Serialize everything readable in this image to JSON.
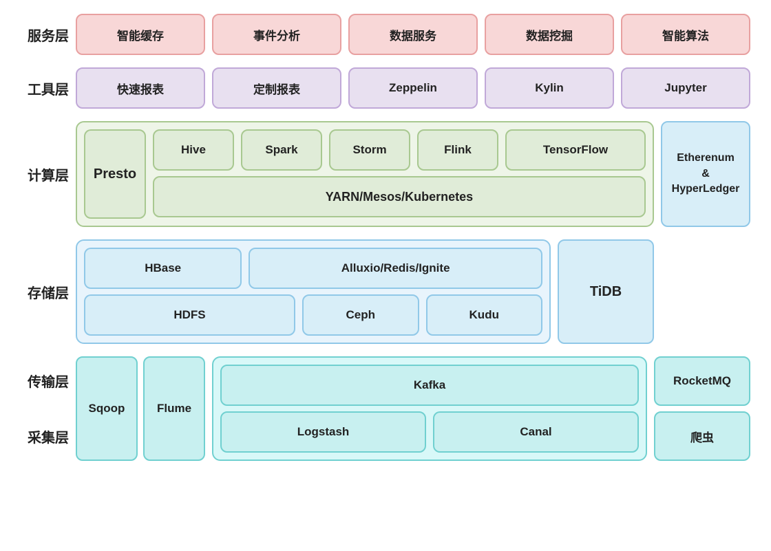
{
  "layers": {
    "service": {
      "label": "服务层",
      "items": [
        "智能缓存",
        "事件分析",
        "数据服务",
        "数据挖掘",
        "智能算法"
      ]
    },
    "tool": {
      "label": "工具层",
      "items": [
        "快速报表",
        "定制报表",
        "Zeppelin",
        "Kylin",
        "Jupyter"
      ]
    },
    "compute": {
      "label": "计算层",
      "presto": "Presto",
      "top_items": [
        "Hive",
        "Spark",
        "Storm",
        "Flink",
        "TensorFlow"
      ],
      "bottom_item": "YARN/Mesos/Kubernetes",
      "ethereum": "Etherenum\n&\nHyperLedger"
    },
    "storage": {
      "label": "存储层",
      "row1": [
        "HBase",
        "Alluxio/Redis/Ignite"
      ],
      "tidb": "TiDB",
      "row2": [
        "HDFS",
        "Ceph",
        "Kudu"
      ]
    },
    "transport_collect": {
      "transport_label": "传输层",
      "collect_label": "采集层",
      "left_items": [
        "Sqoop",
        "Flume"
      ],
      "right_top": "Kafka",
      "right_bottom_items": [
        "Logstash",
        "Canal"
      ],
      "far_right_top": "RocketMQ",
      "far_right_bottom": "爬虫"
    }
  }
}
